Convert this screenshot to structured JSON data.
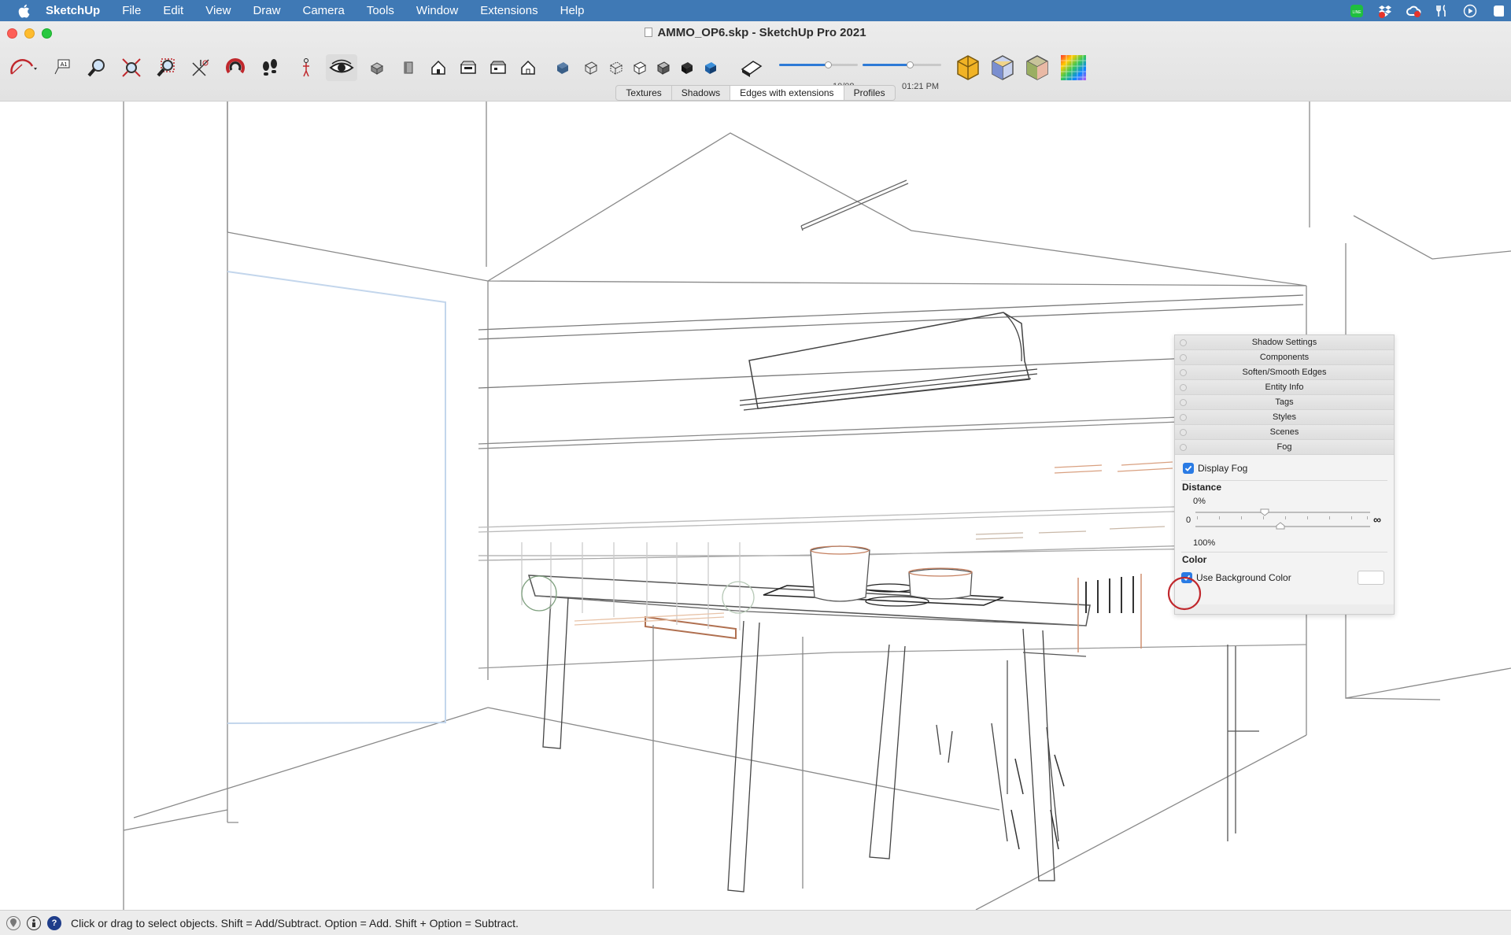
{
  "menubar": {
    "app_name": "SketchUp",
    "items": [
      "File",
      "Edit",
      "View",
      "Draw",
      "Camera",
      "Tools",
      "Window",
      "Extensions",
      "Help"
    ],
    "status_icons": [
      "line-icon",
      "dropbox-icon",
      "creative-cloud-icon",
      "tools-icon",
      "play-icon"
    ]
  },
  "window": {
    "title": "AMMO_OP6.skp - SketchUp Pro 2021"
  },
  "shadow_sliders": {
    "date": "10/08",
    "time": "01:21 PM",
    "date_level": 0.62,
    "time_level": 0.6
  },
  "style_tabs": {
    "items": [
      "Textures",
      "Shadows",
      "Edges with extensions",
      "Profiles"
    ],
    "active": "Edges with extensions"
  },
  "tray": {
    "sections": [
      "Shadow Settings",
      "Components",
      "Soften/Smooth Edges",
      "Entity Info",
      "Tags",
      "Styles",
      "Scenes",
      "Fog"
    ],
    "fog": {
      "display_fog_label": "Display Fog",
      "display_fog_checked": true,
      "distance_label": "Distance",
      "start_value": "0%",
      "end_value": "100%",
      "scale_min": "0",
      "scale_max": "∞",
      "color_label": "Color",
      "use_bg_label": "Use Background Color",
      "use_bg_checked": true,
      "color_swatch": "#ffffff"
    }
  },
  "statusbar": {
    "text": "Click or drag to select objects. Shift = Add/Subtract. Option = Add. Shift + Option = Subtract."
  },
  "colors": {
    "menubar_bg": "#3f79b5",
    "accent": "#2a7be4",
    "highlight_circle": "#c0282d"
  }
}
